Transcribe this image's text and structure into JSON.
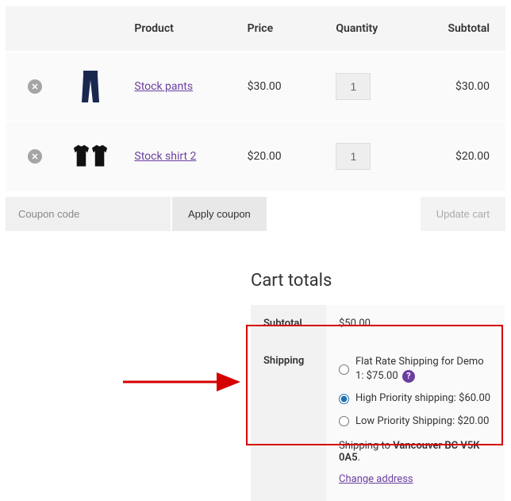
{
  "headers": {
    "product": "Product",
    "price": "Price",
    "quantity": "Quantity",
    "subtotal": "Subtotal"
  },
  "items": [
    {
      "name": "Stock pants",
      "price": "$30.00",
      "qty": "1",
      "subtotal": "$30.00",
      "icon": "pants"
    },
    {
      "name": "Stock shirt 2",
      "price": "$20.00",
      "qty": "1",
      "subtotal": "$20.00",
      "icon": "shirts"
    }
  ],
  "coupon": {
    "placeholder": "Coupon code",
    "apply": "Apply coupon"
  },
  "update": "Update cart",
  "totals": {
    "title": "Cart totals",
    "subtotal_label": "Subtotal",
    "subtotal_value": "$50.00",
    "shipping_label": "Shipping",
    "options": [
      {
        "label": "Flat Rate Shipping for Demo 1: $75.00",
        "checked": false,
        "help": true
      },
      {
        "label": "High Priority shipping: $60.00",
        "checked": true,
        "help": false
      },
      {
        "label": "Low Priority Shipping: $20.00",
        "checked": false,
        "help": false
      }
    ],
    "dest_prefix": "Shipping to ",
    "dest_bold": "Vancouver BC V5K 0A5",
    "dest_suffix": ".",
    "change": "Change address"
  }
}
